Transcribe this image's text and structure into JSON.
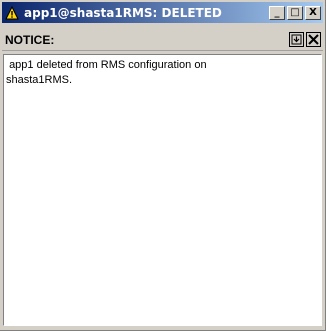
{
  "window": {
    "title": "app1@shasta1RMS: DELETED",
    "icon": "warning-triangle-icon",
    "minimize_label": "_",
    "maximize_label": "□",
    "close_label": "X",
    "titlebar_color": "#0a246a"
  },
  "notice": {
    "label": "NOTICE:",
    "undock_icon": "undock-icon",
    "close_icon": "close-icon"
  },
  "message": {
    "text": " app1 deleted from RMS configuration on\nshasta1RMS."
  }
}
